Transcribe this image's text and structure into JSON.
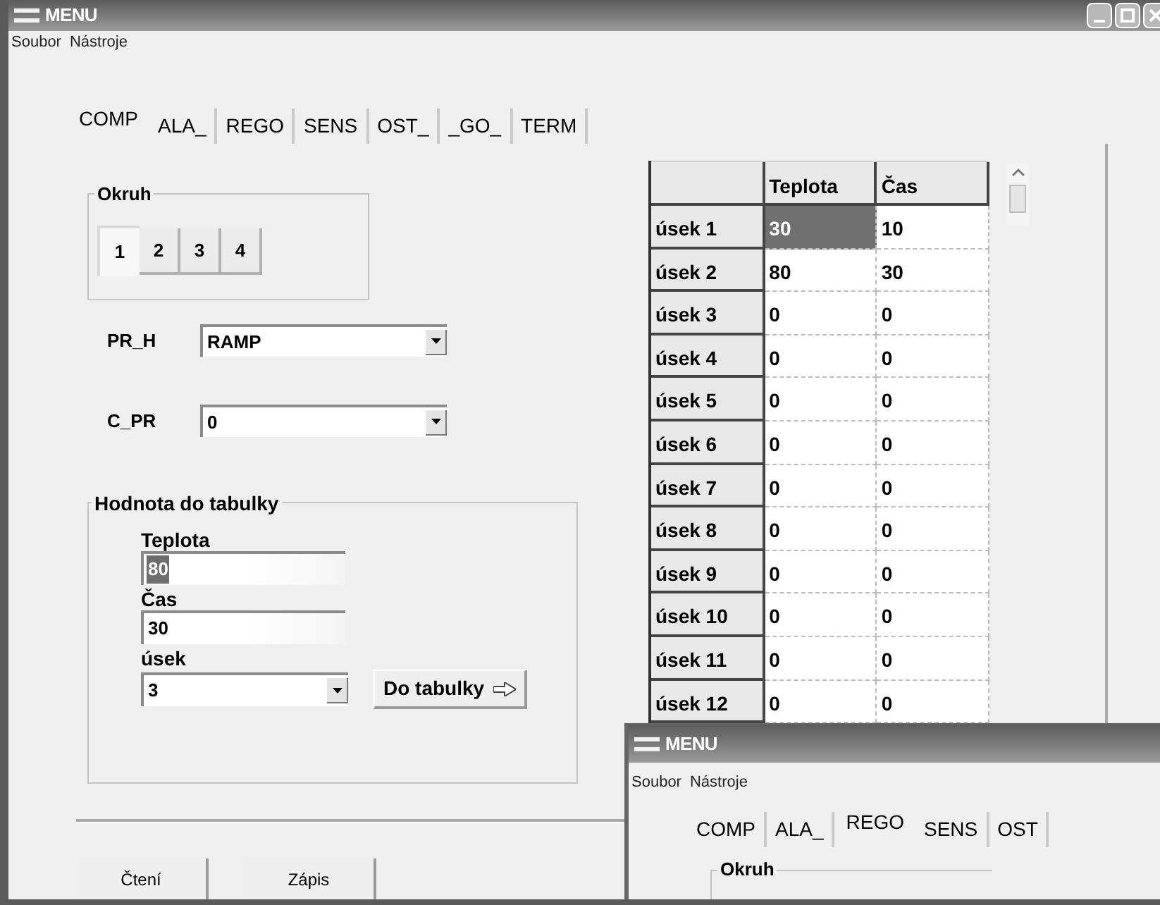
{
  "main_window": {
    "title": "MENU",
    "menu": [
      "Soubor",
      "Nástroje"
    ],
    "tabs": [
      {
        "label": "COMP",
        "selected": true
      },
      {
        "label": "ALA_",
        "selected": false
      },
      {
        "label": "REGO",
        "selected": false
      },
      {
        "label": "SENS",
        "selected": false
      },
      {
        "label": "OST_",
        "selected": false
      },
      {
        "label": "_GO_",
        "selected": false
      },
      {
        "label": "TERM",
        "selected": false
      }
    ],
    "okruh": {
      "title": "Okruh",
      "buttons": [
        {
          "label": "1",
          "selected": true
        },
        {
          "label": "2",
          "selected": false
        },
        {
          "label": "3",
          "selected": false
        },
        {
          "label": "4",
          "selected": false
        }
      ]
    },
    "combos": [
      {
        "label": "PR_H",
        "value": "RAMP"
      },
      {
        "label": "C_PR",
        "value": "0"
      }
    ],
    "value_group": {
      "title": "Hodnota do tabulky",
      "fields": [
        {
          "kind": "text",
          "label": "Teplota",
          "value": "80",
          "selected": true
        },
        {
          "kind": "text",
          "label": "Čas",
          "value": "30",
          "selected": false
        },
        {
          "kind": "combo",
          "label": "úsek",
          "value": "3"
        }
      ],
      "button": "Do tabulky"
    },
    "table": {
      "columns": [
        "Teplota",
        "Čas"
      ],
      "rows": [
        {
          "label": "úsek 1",
          "cells": [
            {
              "text": "30",
              "selected": true
            },
            {
              "text": "10",
              "selected": false
            }
          ]
        },
        {
          "label": "úsek 2",
          "cells": [
            {
              "text": "80",
              "selected": false
            },
            {
              "text": "30",
              "selected": false
            }
          ]
        },
        {
          "label": "úsek 3",
          "cells": [
            {
              "text": "0",
              "selected": false
            },
            {
              "text": "0",
              "selected": false
            }
          ]
        },
        {
          "label": "úsek 4",
          "cells": [
            {
              "text": "0",
              "selected": false
            },
            {
              "text": "0",
              "selected": false
            }
          ]
        },
        {
          "label": "úsek 5",
          "cells": [
            {
              "text": "0",
              "selected": false
            },
            {
              "text": "0",
              "selected": false
            }
          ]
        },
        {
          "label": "úsek 6",
          "cells": [
            {
              "text": "0",
              "selected": false
            },
            {
              "text": "0",
              "selected": false
            }
          ]
        },
        {
          "label": "úsek 7",
          "cells": [
            {
              "text": "0",
              "selected": false
            },
            {
              "text": "0",
              "selected": false
            }
          ]
        },
        {
          "label": "úsek 8",
          "cells": [
            {
              "text": "0",
              "selected": false
            },
            {
              "text": "0",
              "selected": false
            }
          ]
        },
        {
          "label": "úsek 9",
          "cells": [
            {
              "text": "0",
              "selected": false
            },
            {
              "text": "0",
              "selected": false
            }
          ]
        },
        {
          "label": "úsek 10",
          "cells": [
            {
              "text": "0",
              "selected": false
            },
            {
              "text": "0",
              "selected": false
            }
          ]
        },
        {
          "label": "úsek 11",
          "cells": [
            {
              "text": "0",
              "selected": false
            },
            {
              "text": "0",
              "selected": false
            }
          ]
        },
        {
          "label": "úsek 12",
          "cells": [
            {
              "text": "0",
              "selected": false
            },
            {
              "text": "0",
              "selected": false
            }
          ]
        }
      ]
    },
    "buttons": [
      "Čtení",
      "Zápis"
    ]
  },
  "second_window": {
    "title": "MENU",
    "menu": [
      "Soubor",
      "Nástroje"
    ],
    "tabs": [
      {
        "label": "COMP",
        "selected": false
      },
      {
        "label": "ALA_",
        "selected": false
      },
      {
        "label": "REGO",
        "selected": true
      },
      {
        "label": "SENS",
        "selected": false
      },
      {
        "label": "OST",
        "selected": false
      }
    ],
    "group_title": "Okruh"
  }
}
